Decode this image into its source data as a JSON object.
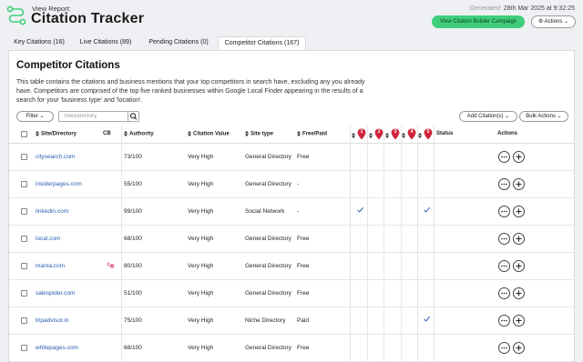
{
  "header": {
    "view_report": "View Report:",
    "title": "Citation Tracker",
    "generated_label": "Generated:",
    "generated_date": "28th Mar 2025 at 9:32:25",
    "campaign_button": "View Citation Builder Campaign",
    "actions_button": "Actions",
    "logo_icon": "route-icon",
    "accent": "#3fcf7a"
  },
  "tabs": [
    {
      "label": "Key Citations (16)"
    },
    {
      "label": "Live Citations (89)"
    },
    {
      "label": "Pending Citations (0)"
    },
    {
      "label": "Competitor Citations (167)"
    }
  ],
  "active_tab": 3,
  "panel": {
    "title": "Competitor Citations",
    "desc_lines": [
      "This table contains the citations and business mentions that your top competitors in search have, excluding any you already",
      "have. Competitors are comprised of the top five ranked businesses within Google Local Finder appearing in the results of a",
      "search for your 'business type' and 'location'."
    ]
  },
  "toolbar": {
    "filter_label": "Filter",
    "search_placeholder": "Site/Directory",
    "add_citation_label": "Add Citation(s)",
    "bulk_actions_label": "Bulk Actions"
  },
  "table": {
    "columns": {
      "site": "Site/Directory",
      "cb": "CB",
      "authority": "Authority",
      "citation_value": "Citation Value",
      "site_type": "Site type",
      "free_paid": "Free/Paid",
      "status": "Status",
      "actions": "Actions"
    },
    "competitor_pins": [
      "1",
      "2",
      "3",
      "4",
      "5"
    ],
    "pin_color": "#d0233a",
    "rows": [
      {
        "site": "citysearch.com",
        "cb": false,
        "authority": "73/100",
        "value": "Very High",
        "type": "General Directory",
        "price": "Free",
        "checks": []
      },
      {
        "site": "insiderpages.com",
        "cb": false,
        "authority": "55/100",
        "value": "Very High",
        "type": "General Directory",
        "price": "-",
        "checks": []
      },
      {
        "site": "linkedin.com",
        "cb": false,
        "authority": "99/100",
        "value": "Very High",
        "type": "Social Network",
        "price": "-",
        "checks": [
          1,
          5
        ]
      },
      {
        "site": "local.com",
        "cb": false,
        "authority": "68/100",
        "value": "Very High",
        "type": "General Directory",
        "price": "Free",
        "checks": []
      },
      {
        "site": "manta.com",
        "cb": true,
        "authority": "80/100",
        "value": "Very High",
        "type": "General Directory",
        "price": "Free",
        "checks": []
      },
      {
        "site": "salespider.com",
        "cb": false,
        "authority": "51/100",
        "value": "Very High",
        "type": "General Directory",
        "price": "Free",
        "checks": []
      },
      {
        "site": "tripadvisor.in",
        "cb": false,
        "authority": "75/100",
        "value": "Very High",
        "type": "Niche Directory",
        "price": "Paid",
        "checks": [
          5
        ]
      },
      {
        "site": "whitepages.com",
        "cb": false,
        "authority": "68/100",
        "value": "Very High",
        "type": "General Directory",
        "price": "Free",
        "checks": []
      }
    ]
  }
}
